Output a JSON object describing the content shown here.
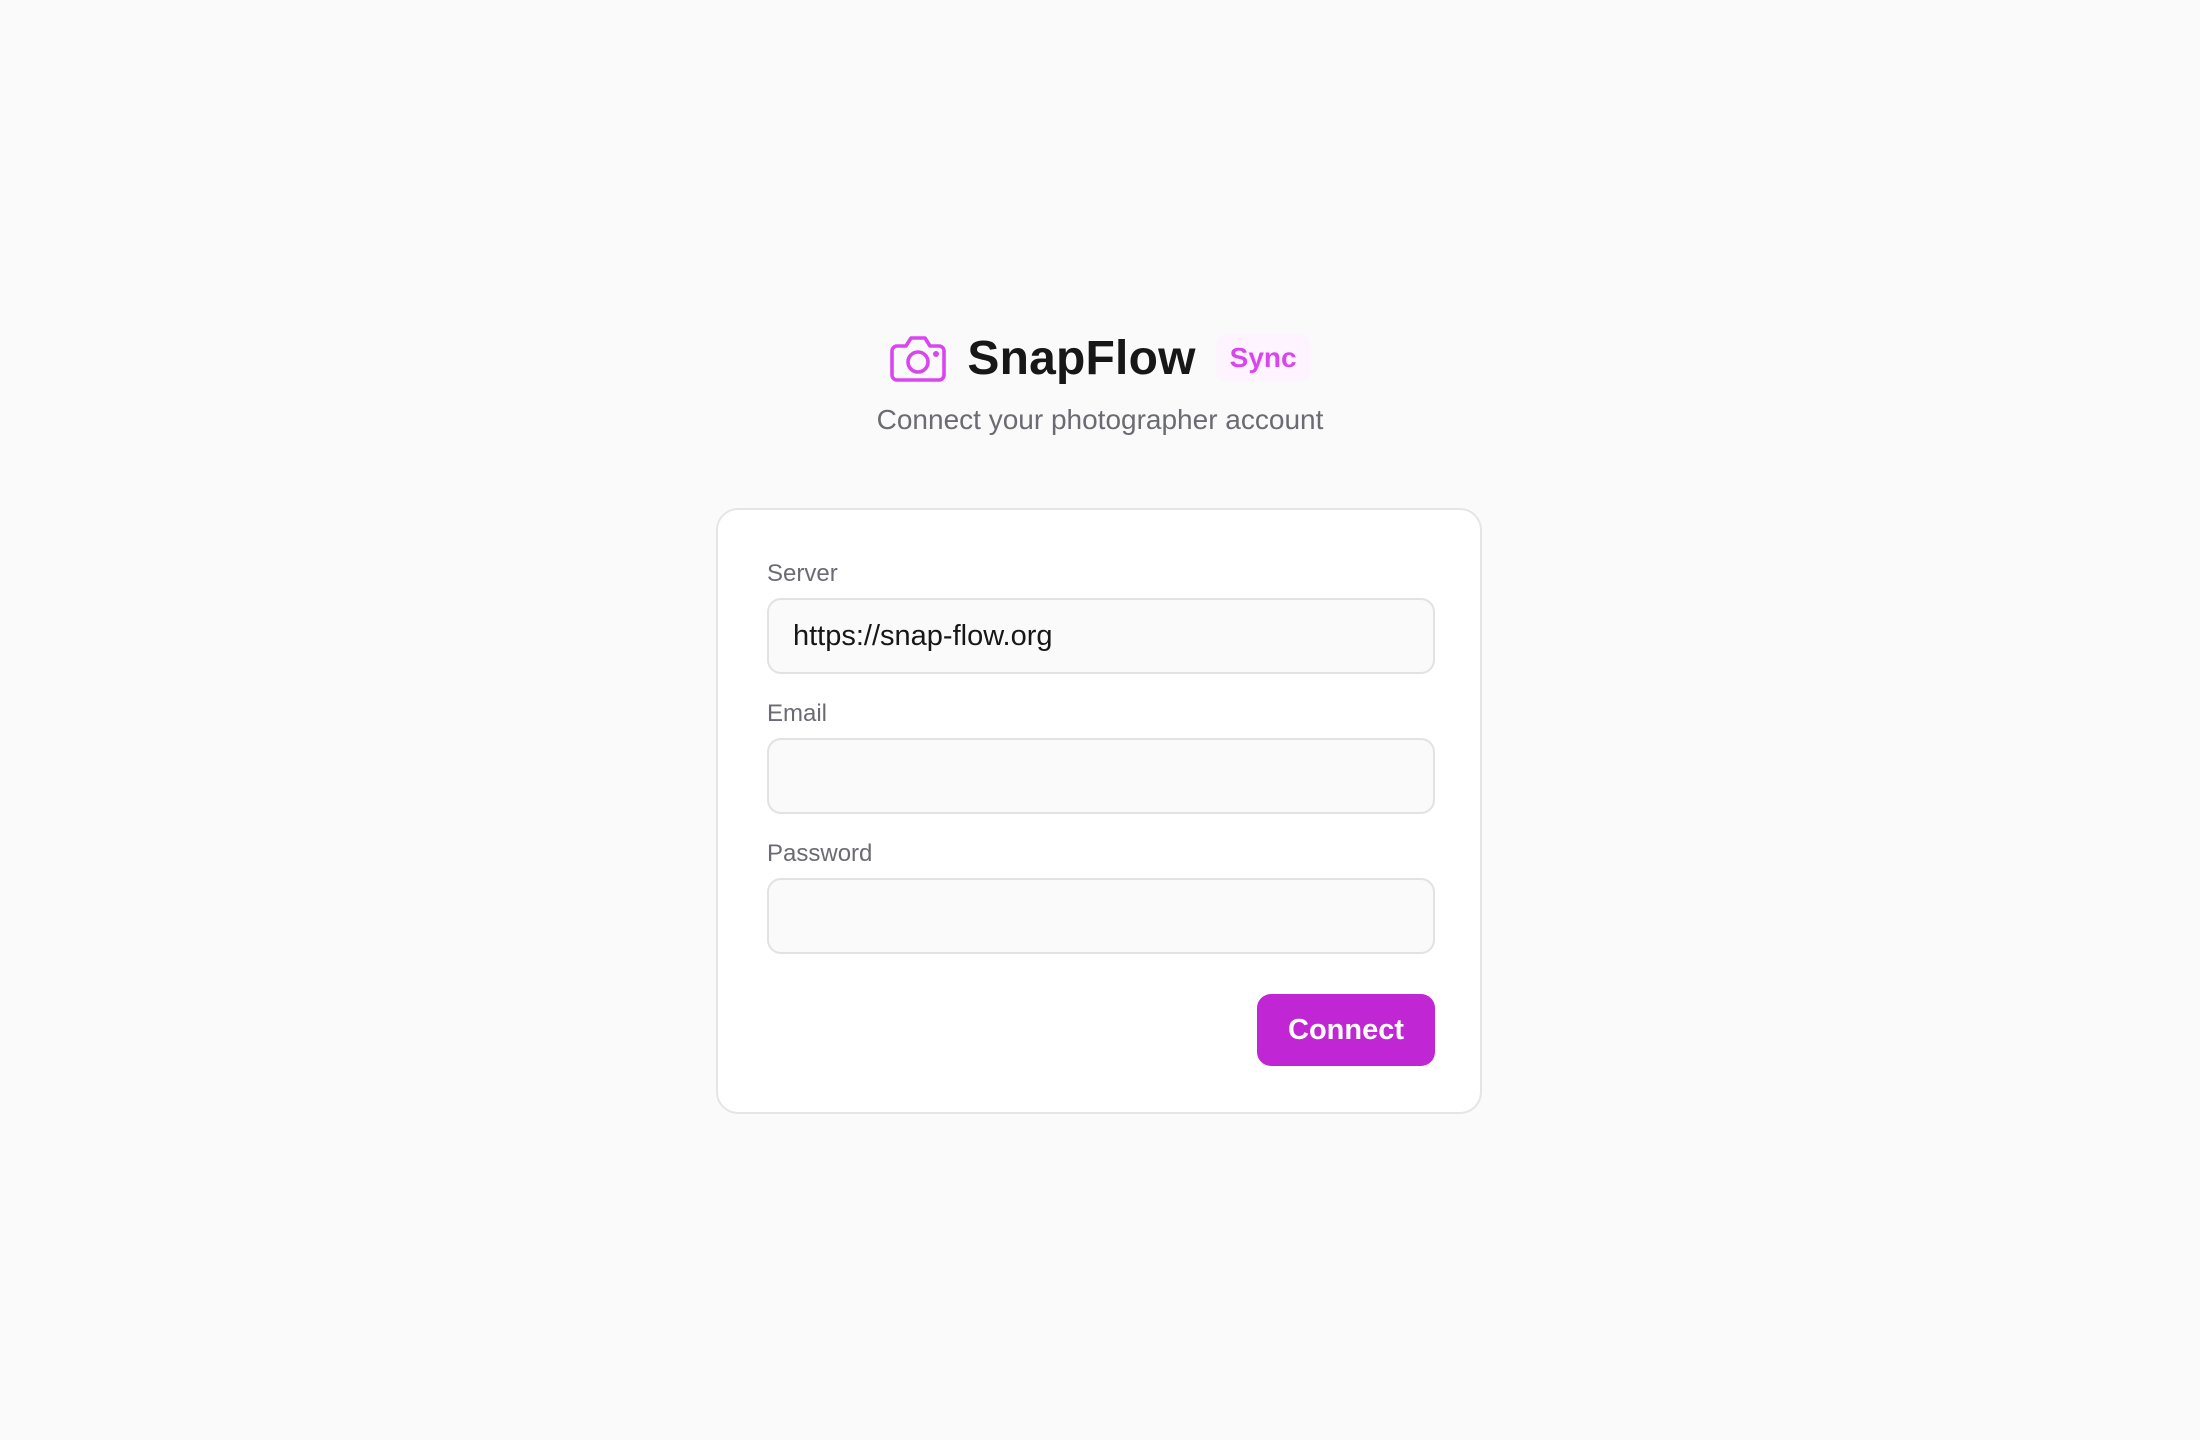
{
  "header": {
    "app_name": "SnapFlow",
    "badge": "Sync",
    "subtitle": "Connect your photographer account",
    "icon": "camera-icon"
  },
  "form": {
    "server": {
      "label": "Server",
      "value": "https://snap-flow.org",
      "placeholder": ""
    },
    "email": {
      "label": "Email",
      "value": "",
      "placeholder": ""
    },
    "password": {
      "label": "Password",
      "value": "",
      "placeholder": ""
    },
    "submit_label": "Connect"
  },
  "colors": {
    "accent": "#c026d3",
    "accent_light": "#d946ef",
    "badge_bg": "#fdf4ff",
    "background": "#fafafa",
    "muted_text": "#6b6b73"
  }
}
